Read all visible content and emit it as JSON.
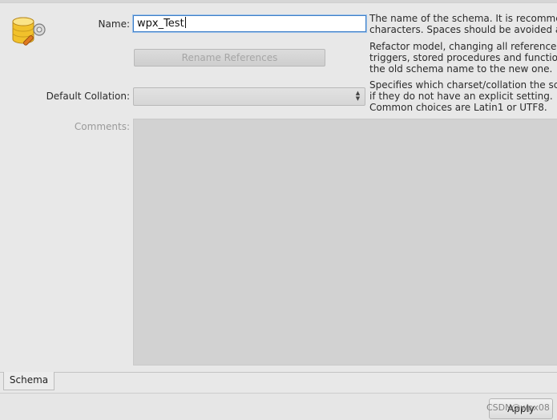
{
  "form": {
    "name_label": "Name:",
    "name_value": "wpx_Test",
    "rename_button_label": "Rename References",
    "collation_label": "Default Collation:",
    "collation_value": "",
    "comments_label": "Comments:"
  },
  "help": {
    "name_line1": "The name of the schema. It is recommen",
    "name_line2": "characters. Spaces should be avoided an",
    "rename_line1": "Refactor model, changing all references",
    "rename_line2": "triggers, stored procedures and functior",
    "rename_line3": "the old schema name to the new one.",
    "collation_line1": "Specifies which charset/collation the sch",
    "collation_line2": "if they do not have an explicit setting.",
    "collation_line3": "Common choices are Latin1 or UTF8."
  },
  "tabs": [
    {
      "label": "Schema"
    }
  ],
  "footer": {
    "apply_label": "Apply",
    "watermark": "CSDN@wpx08"
  },
  "icons": {
    "schema": "database-wrench-icon",
    "select_arrows": "up-down-arrows-icon"
  },
  "colors": {
    "accent": "#3f7fc8",
    "background": "#e8e8e8"
  }
}
